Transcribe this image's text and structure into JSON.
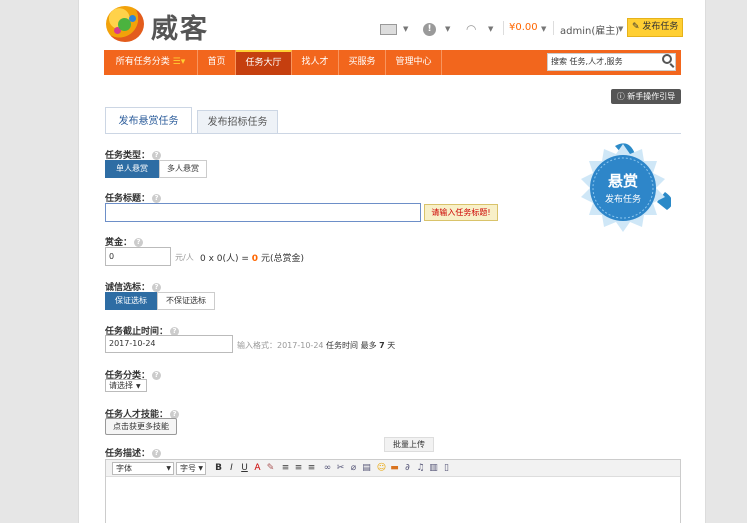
{
  "brand": {
    "name": "威客"
  },
  "header": {
    "money": "¥0.00",
    "user": "admin(雇主)",
    "post_task": "发布任务"
  },
  "nav": {
    "categories": "所有任务分类",
    "items": [
      "首页",
      "任务大厅",
      "找人才",
      "买服务",
      "管理中心"
    ],
    "active_index": 1,
    "search_placeholder": "搜索 任务,人才,服务"
  },
  "guide_button": "新手操作引导",
  "tabs": [
    "发布悬赏任务",
    "发布招标任务"
  ],
  "badge": {
    "line1": "悬赏",
    "line2": "发布任务"
  },
  "form": {
    "task_type": {
      "label": "任务类型：",
      "options": [
        "单人悬赏",
        "多人悬赏"
      ]
    },
    "task_title": {
      "label": "任务标题：",
      "error": "请输入任务标题!"
    },
    "reward": {
      "label": "赏金：",
      "value": "0",
      "unit": "元/人",
      "formula": "0 x 0(人) = ",
      "total": "0",
      "total_suffix": "元(总赏金)"
    },
    "deposit": {
      "label": "诚信选标：",
      "options": [
        "保证选标",
        "不保证选标"
      ]
    },
    "deadline": {
      "label": "任务截止时间：",
      "value": "2017-10-24",
      "hint_prefix": "输入格式：",
      "hint_date": "2017-10-24",
      "hint_mid": "任务时间 最多",
      "hint_days": "7",
      "hint_suffix": "天"
    },
    "category": {
      "label": "任务分类：",
      "selected": "请选择"
    },
    "skills": {
      "label": "任务人才技能：",
      "button": "点击获更多技能"
    },
    "description": {
      "label": "任务描述：",
      "font_select": "字体",
      "size_select": "字号",
      "tooltip": "批量上传"
    }
  }
}
